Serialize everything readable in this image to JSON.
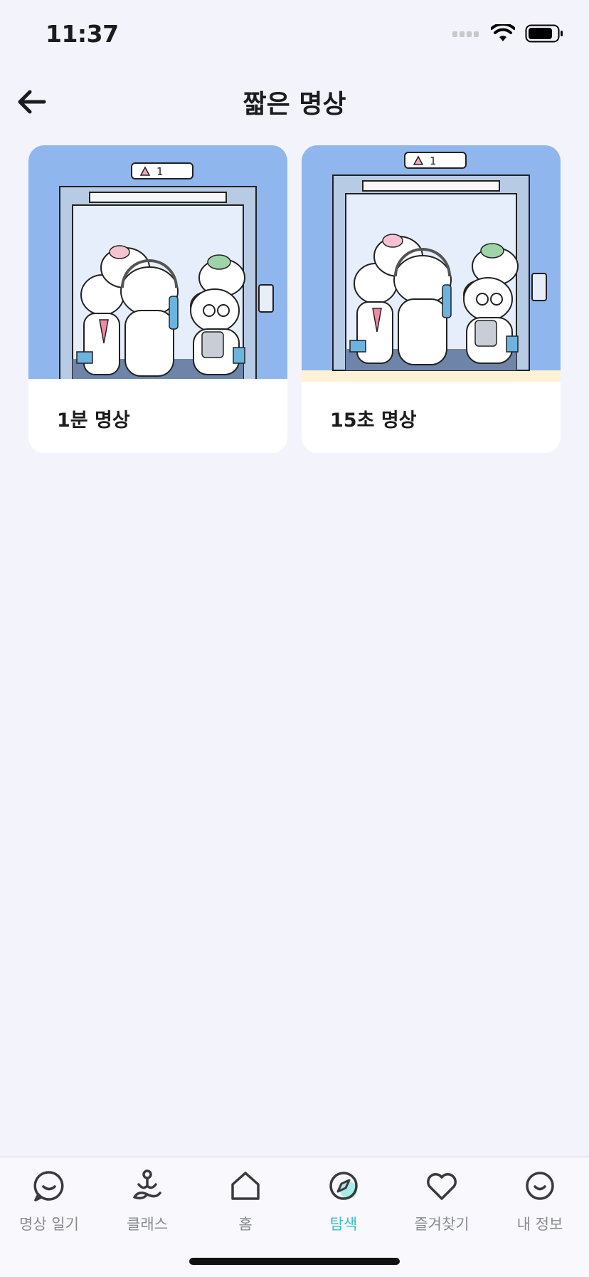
{
  "status_bar": {
    "time": "11:37"
  },
  "header": {
    "title": "짧은 명상"
  },
  "cards": [
    {
      "title": "1분 명상",
      "floor_label": "1",
      "floor_color": "#9ec2f0"
    },
    {
      "title": "15초 명상",
      "floor_label": "1",
      "floor_color": "#fff1d6"
    }
  ],
  "tabbar": {
    "tabs": [
      {
        "label": "명상 일기",
        "icon": "chat-smile-icon",
        "active": false
      },
      {
        "label": "클래스",
        "icon": "meditation-person-icon",
        "active": false
      },
      {
        "label": "홈",
        "icon": "home-icon",
        "active": false
      },
      {
        "label": "탐색",
        "icon": "compass-icon",
        "active": true
      },
      {
        "label": "즐겨찾기",
        "icon": "heart-icon",
        "active": false
      },
      {
        "label": "내 정보",
        "icon": "smile-icon",
        "active": false
      }
    ],
    "active_color": "#35c3bf",
    "inactive_color": "#8a8a93"
  }
}
